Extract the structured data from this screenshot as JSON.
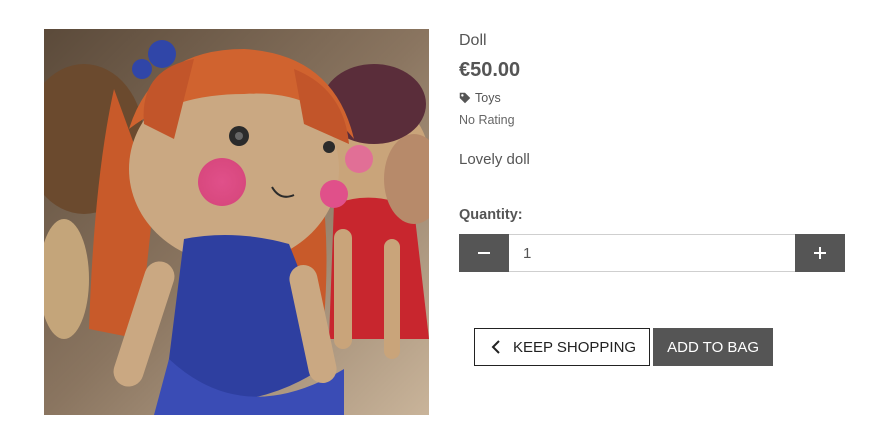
{
  "product": {
    "name": "Doll",
    "price": "€50.00",
    "category": "Toys",
    "category_icon": "tag-icon",
    "rating": "No Rating",
    "description": "Lovely doll",
    "image_alt": "Crocheted doll with orange hair and blue dress"
  },
  "quantity": {
    "label": "Quantity:",
    "value": "1",
    "decrement_icon": "minus-icon",
    "increment_icon": "plus-icon"
  },
  "actions": {
    "keep_shopping_label": "Keep Shopping",
    "keep_shopping_icon": "chevron-left-icon",
    "add_to_bag_label": "Add to Bag"
  },
  "colors": {
    "button_dark": "#555555",
    "text": "#555555",
    "border": "#222222"
  }
}
